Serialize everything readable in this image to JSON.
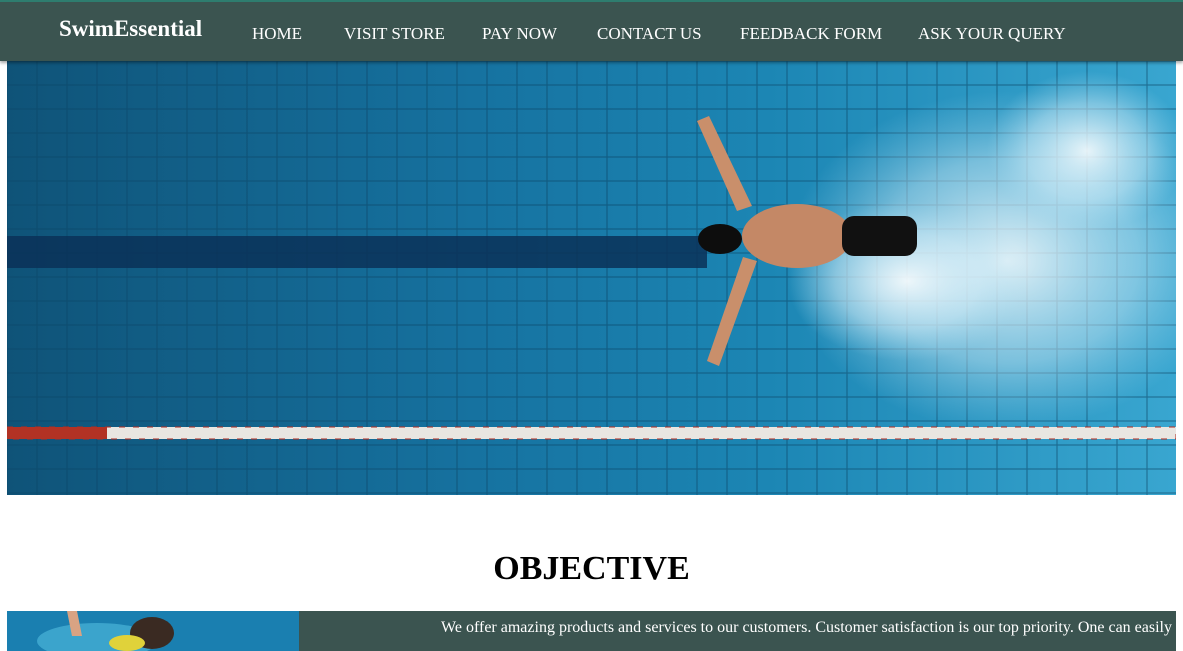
{
  "nav": {
    "brand": "SwimEssential",
    "items": [
      {
        "label": "HOME"
      },
      {
        "label": "VISIT STORE"
      },
      {
        "label": "PAY NOW"
      },
      {
        "label": "CONTACT US"
      },
      {
        "label": "FEEDBACK FORM"
      },
      {
        "label": "ASK YOUR QUERY"
      }
    ]
  },
  "hero": {
    "image_subject": "swimmer doing butterfly stroke in pool lane, top view"
  },
  "objective": {
    "title": "OBJECTIVE",
    "text": "We offer amazing products and services to our customers. Customer satisfaction is our top priority. One can easily",
    "image_subject": "swimmer in water"
  },
  "colors": {
    "navbar": "#3b5450",
    "nav_text": "#ffffff",
    "panel": "#3b5450",
    "pool_water": "#1d87b3"
  }
}
